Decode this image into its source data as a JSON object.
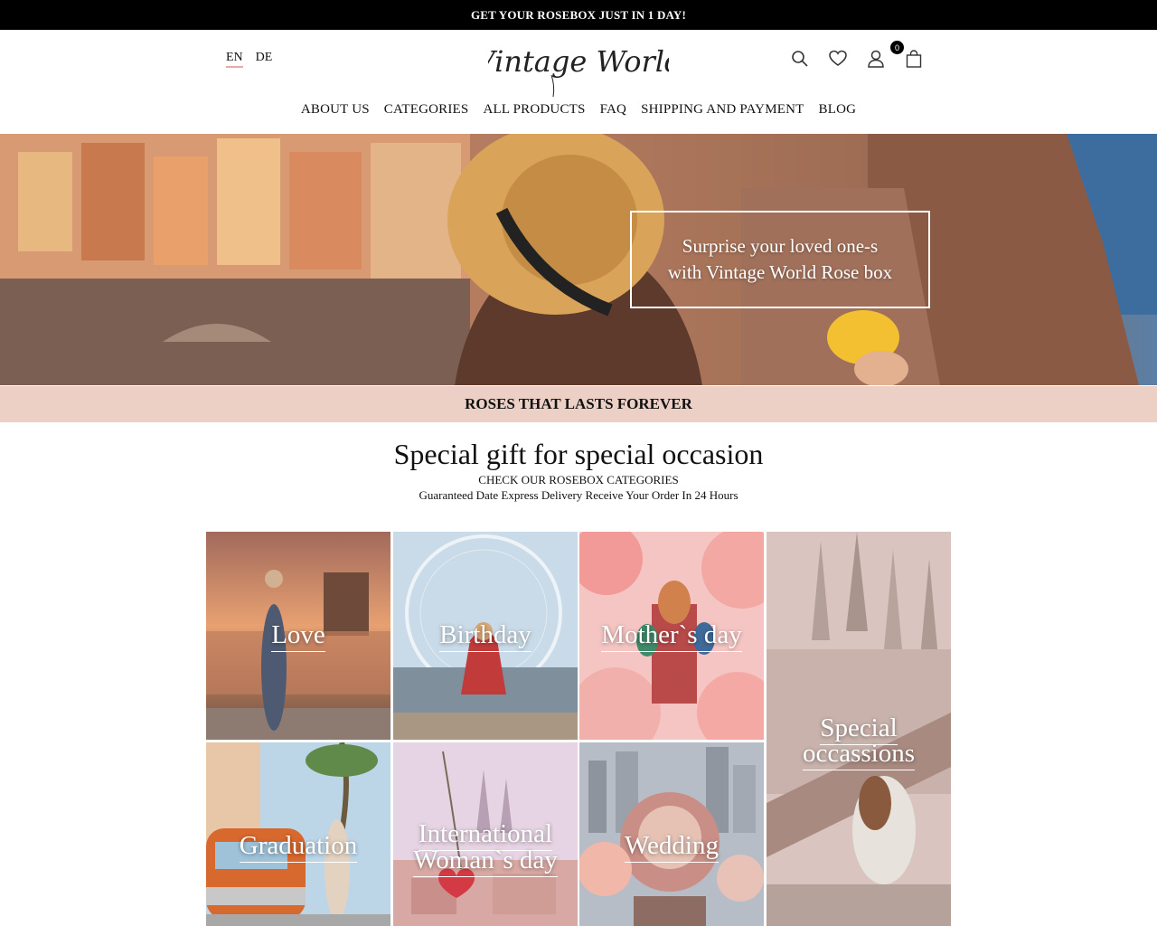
{
  "announcement": "GET YOUR ROSEBOX JUST IN 1 DAY!",
  "languages": [
    {
      "code": "EN",
      "active": true
    },
    {
      "code": "DE",
      "active": false
    }
  ],
  "brand": {
    "logo_text": "Vintage World"
  },
  "header_icons": [
    "search-icon",
    "heart-icon",
    "user-icon",
    "shopping-bag-icon"
  ],
  "cart": {
    "count": "0"
  },
  "nav": [
    "ABOUT US",
    "CATEGORIES",
    "ALL PRODUCTS",
    "FAQ",
    "SHIPPING AND PAYMENT",
    "BLOG"
  ],
  "hero": {
    "line1": "Surprise your loved one-s",
    "line2": "with Vintage World Rose box"
  },
  "band_text": "ROSES THAT LASTS FOREVER",
  "section": {
    "title": "Special gift for special occasion",
    "subtitle": "CHECK OUR ROSEBOX CATEGORIES",
    "delivery": "Guaranteed Date Express Delivery Receive Your Order In 24 Hours"
  },
  "categories": [
    {
      "label": "Love"
    },
    {
      "label": "Birthday"
    },
    {
      "label": "Mother`s day"
    },
    {
      "label": "Special occassions"
    },
    {
      "label": "Graduation"
    },
    {
      "label": "International Woman`s day"
    },
    {
      "label": "Wedding"
    }
  ],
  "colors": {
    "topbar": "#000000",
    "band": "#ecd0c6",
    "accent": "#e7a9a9"
  }
}
